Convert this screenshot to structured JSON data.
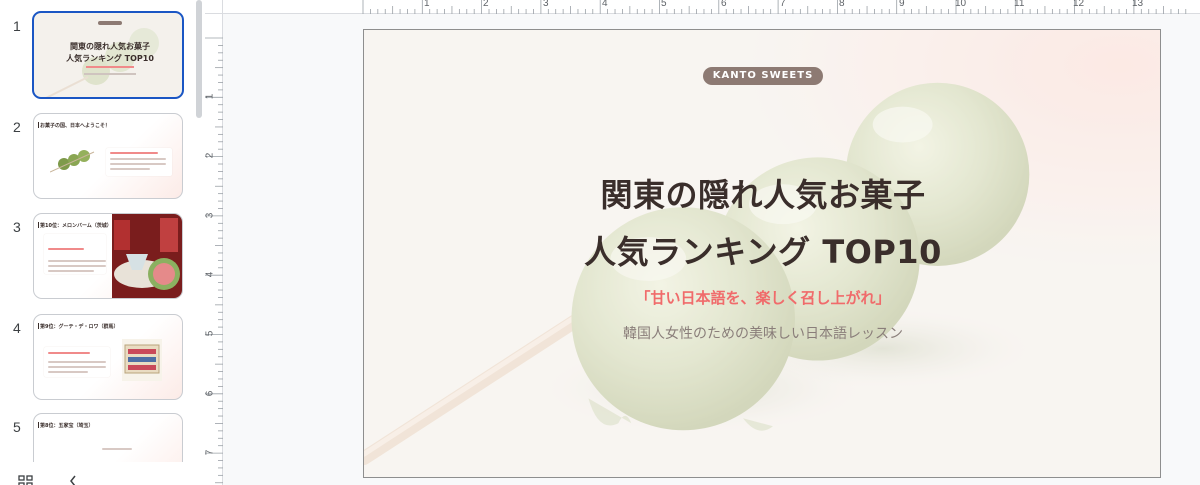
{
  "filmstrip": {
    "slides": [
      {
        "number": "1",
        "selected": true
      },
      {
        "number": "2",
        "title": "お菓子の国、日本へようこそ！"
      },
      {
        "number": "3",
        "title": "第10位：メロンバーム（茨城）"
      },
      {
        "number": "4",
        "title": "第9位：グーテ・デ・ロワ（群馬）"
      },
      {
        "number": "5",
        "title": "第8位：五家宝（埼玉）"
      }
    ],
    "slide1_thumb": {
      "title_line1": "関東の隠れ人気お菓子",
      "title_line2": "人気ランキング TOP10"
    }
  },
  "bottom_tools": {
    "grid_icon": "grid-view-icon",
    "collapse_icon": "chevron-left-icon"
  },
  "ruler": {
    "h_labels": [
      "1",
      "2",
      "3",
      "4",
      "5",
      "6",
      "7",
      "8",
      "9",
      "10",
      "11",
      "12",
      "13"
    ],
    "v_labels": [
      "1",
      "2",
      "3",
      "4",
      "5",
      "6",
      "7"
    ]
  },
  "slide": {
    "badge": "KANTO SWEETS",
    "title_line1": "関東の隠れ人気お菓子",
    "title_line2": "人気ランキング TOP10",
    "tagline": "「甘い日本語を、楽しく召し上がれ」",
    "subtitle": "韓国人女性のための美味しい日本語レッスン",
    "colors": {
      "title": "#3a2e2b",
      "tagline": "#f06b6b",
      "badge_bg": "#8d7a73",
      "subtitle": "#8a7e7a"
    }
  }
}
